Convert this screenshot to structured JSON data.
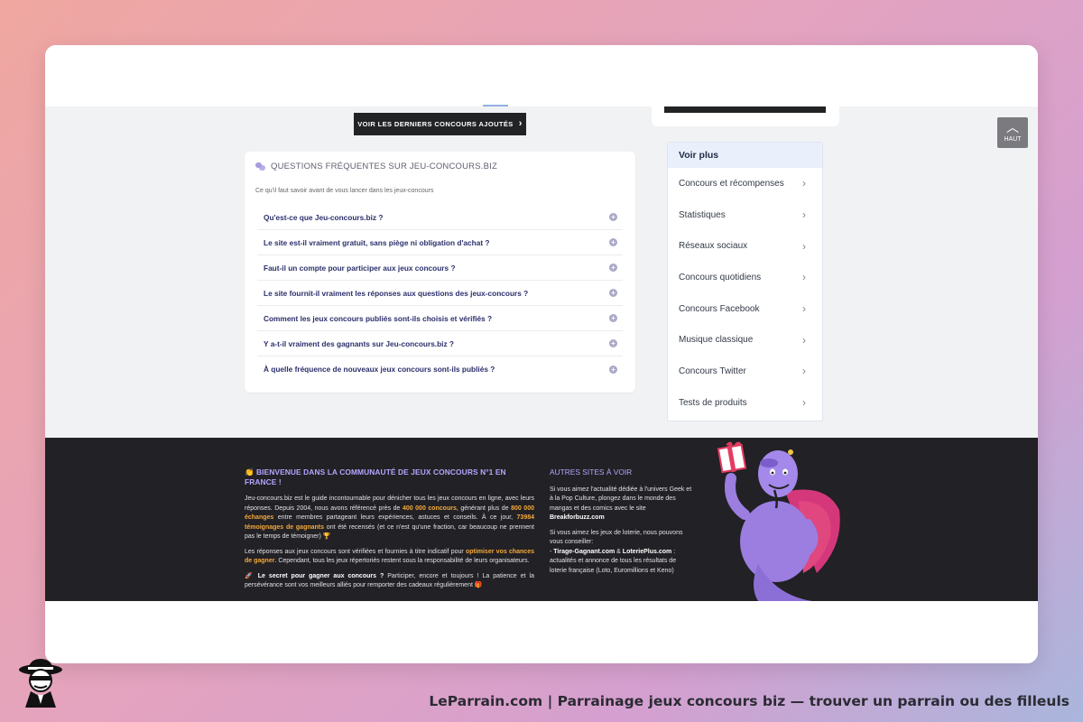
{
  "cta": {
    "label": "VOIR LES DERNIERS CONCOURS AJOUTÉS",
    "chevron": "chevron-right-icon"
  },
  "faq": {
    "title": "QUESTIONS FRÉQUENTES SUR JEU-CONCOURS.BIZ",
    "subtitle": "Ce qu'il faut savoir avant de vous lancer dans les jeux-concours",
    "items": [
      "Qu'est-ce que Jeu-concours.biz ?",
      "Le site est-il vraiment gratuit, sans piège ni obligation d'achat ?",
      "Faut-il un compte pour participer aux jeux concours ?",
      "Le site fournit-il vraiment les réponses aux questions des jeux-concours ?",
      "Comment les jeux concours publiés sont-ils choisis et vérifiés ?",
      "Y a-t-il vraiment des gagnants sur Jeu-concours.biz ?",
      "À quelle fréquence de nouveaux jeux concours sont-ils publiés ?"
    ]
  },
  "voirplus": {
    "title": "Voir plus",
    "items": [
      "Concours et récompenses",
      "Statistiques",
      "Réseaux sociaux",
      "Concours quotidiens",
      "Concours Facebook",
      "Musique classique",
      "Concours Twitter",
      "Tests de produits"
    ]
  },
  "haut": {
    "label": "HAUT"
  },
  "footer": {
    "left": {
      "title": "BIENVENUE DANS LA COMMUNAUTÉ DE JEUX CONCOURS N°1 EN FRANCE !",
      "p1_a": "Jeu-concours.biz est le guide incontournable pour dénicher tous les jeux concours en ligne, avec leurs réponses. Depuis 2004, nous avons référencé près de ",
      "p1_hl1": "400 000 concours",
      "p1_b": ", générant plus de ",
      "p1_hl2": "800 000 échanges",
      "p1_c": " entre membres partageant leurs expériences, astuces et conseils. À ce jour, ",
      "p1_hl3": "73984 témoignages de gagnants",
      "p1_d": " ont été recensés (et ce n'est qu'une fraction, car beaucoup ne prennent pas le temps de témoigner) 🏆",
      "p2_a": "Les réponses aux jeux concours sont vérifiées et fournies à titre indicatif pour ",
      "p2_hl": "optimiser vos chances de gagner",
      "p2_b": ". Cependant, tous les jeux répertoriés restent sous la responsabilité de leurs organisateurs.",
      "p3_bold": "🚀 Le secret pour gagner aux concours ?",
      "p3_rest": " Participer, encore et toujours ! La patience et la persévérance sont vos meilleurs alliés pour remporter des cadeaux régulièrement 🎁"
    },
    "mid": {
      "title": "AUTRES SITES À VOIR",
      "p1": "Si vous aimez l'actualité dédiée à l'univers Geek et à la Pop Culture, plongez dans le monde des mangas et des comics avec le site ",
      "p1_link": "Breakforbuzz.com",
      "p2": "Si vous aimez les jeux de loterie, nous pouvons vous conseiller:",
      "p3_prefix": "- ",
      "p3_link1": "Tirage-Gagnant.com",
      "p3_and": " & ",
      "p3_link2": "LoteriePlus.com",
      "p3_rest": " : actualités et annonce de tous les résultats de loterie française (Loto, Euromillions et Keno)"
    }
  },
  "caption": "LeParrain.com | Parrainage jeux concours biz — trouver un parrain ou des filleuls",
  "colors": {
    "accent": "#b3a6ff",
    "highlight": "#f4a93c",
    "footer_bg": "#222125",
    "dark_button": "#222325"
  }
}
